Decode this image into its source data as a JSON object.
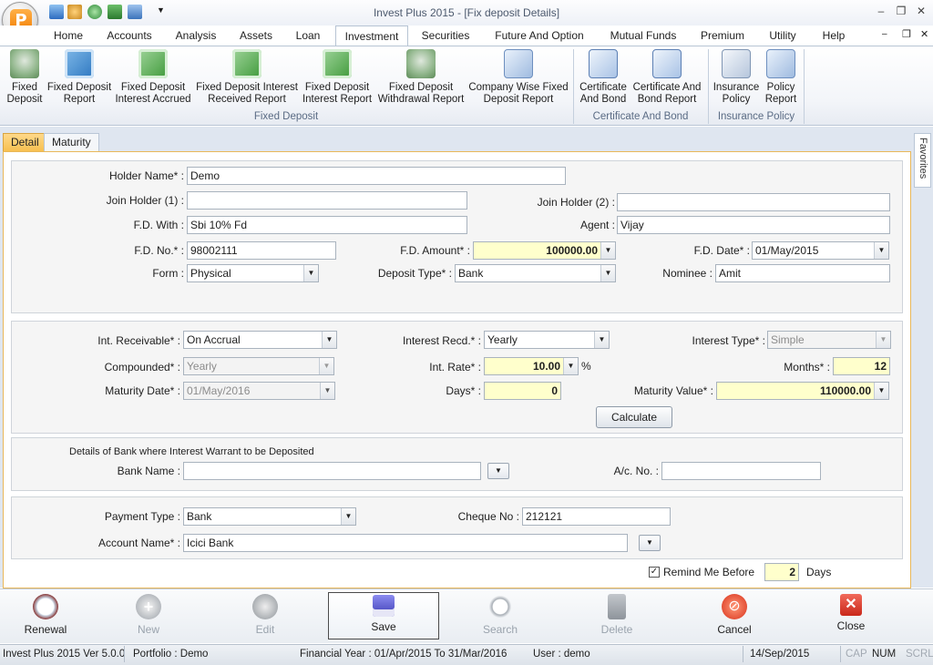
{
  "window": {
    "title": "Invest Plus 2015 - [Fix deposit Details]",
    "logo_letter": "P"
  },
  "menu_tabs": [
    {
      "label": "Home"
    },
    {
      "label": "Accounts"
    },
    {
      "label": "Analysis"
    },
    {
      "label": "Assets"
    },
    {
      "label": "Loan"
    },
    {
      "label": "Investment"
    },
    {
      "label": "Securities"
    },
    {
      "label": "Future And Option"
    },
    {
      "label": "Mutual Funds"
    },
    {
      "label": "Premium"
    },
    {
      "label": "Utility"
    },
    {
      "label": "Help"
    }
  ],
  "active_tab": "Investment",
  "ribbon": {
    "fixed_deposit": {
      "group_label": "Fixed Deposit",
      "buttons": [
        {
          "label": "Fixed\nDeposit",
          "icon": "money-bag-icon"
        },
        {
          "label": "Fixed Deposit\nReport",
          "icon": "report-icon"
        },
        {
          "label": "Fixed Deposit\nInterest Accrued",
          "icon": "calculator-icon"
        },
        {
          "label": "Fixed Deposit Interest\nReceived Report",
          "icon": "calculator-icon"
        },
        {
          "label": "Fixed Deposit\nInterest Report",
          "icon": "calculator-icon"
        },
        {
          "label": "Fixed Deposit\nWithdrawal Report",
          "icon": "withdrawal-icon"
        },
        {
          "label": "Company Wise Fixed\nDeposit Report",
          "icon": "report-icon"
        }
      ]
    },
    "certificate": {
      "group_label": "Certificate And Bond",
      "buttons": [
        {
          "label": "Certificate\nAnd Bond",
          "icon": "certificate-icon"
        },
        {
          "label": "Certificate And\nBond Report",
          "icon": "certificate-report-icon"
        }
      ]
    },
    "insurance": {
      "group_label": "Insurance Policy",
      "buttons": [
        {
          "label": "Insurance\nPolicy",
          "icon": "insurance-icon"
        },
        {
          "label": "Policy\nReport",
          "icon": "policy-report-icon"
        }
      ]
    }
  },
  "sub_tabs": [
    {
      "label": "Detail"
    },
    {
      "label": "Maturity"
    }
  ],
  "favorites_label": "Favorites",
  "form": {
    "holder_name": {
      "label": "Holder Name* :",
      "value": "Demo"
    },
    "join_holder_1": {
      "label": "Join Holder (1) :",
      "value": ""
    },
    "join_holder_2": {
      "label": "Join Holder (2) :",
      "value": ""
    },
    "fd_with": {
      "label": "F.D. With :",
      "value": "Sbi 10% Fd"
    },
    "agent": {
      "label": "Agent :",
      "value": "Vijay"
    },
    "fd_no": {
      "label": "F.D. No.* :",
      "value": "98002111"
    },
    "fd_amount": {
      "label": "F.D. Amount* :",
      "value": "100000.00"
    },
    "fd_date": {
      "label": "F.D. Date* :",
      "value": "01/May/2015"
    },
    "form_type": {
      "label": "Form :",
      "value": "Physical"
    },
    "deposit_type": {
      "label": "Deposit Type* :",
      "value": "Bank"
    },
    "nominee": {
      "label": "Nominee :",
      "value": "Amit"
    },
    "int_receivable": {
      "label": "Int. Receivable* :",
      "value": "On Accrual"
    },
    "interest_recd": {
      "label": "Interest Recd.* :",
      "value": "Yearly"
    },
    "interest_type": {
      "label": "Interest Type* :",
      "value": "Simple"
    },
    "compounded": {
      "label": "Compounded* :",
      "value": "Yearly"
    },
    "int_rate": {
      "label": "Int. Rate* :",
      "value": "10.00",
      "unit": "%"
    },
    "months": {
      "label": "Months* :",
      "value": "12"
    },
    "maturity_date": {
      "label": "Maturity Date* :",
      "value": "01/May/2016"
    },
    "days": {
      "label": "Days* :",
      "value": "0"
    },
    "maturity_value": {
      "label": "Maturity Value* :",
      "value": "110000.00"
    },
    "calculate_label": "Calculate",
    "bank_section_title": "Details of Bank where Interest Warrant to be Deposited",
    "bank_name": {
      "label": "Bank Name :",
      "value": ""
    },
    "ac_no": {
      "label": "A/c. No. :",
      "value": ""
    },
    "payment_type": {
      "label": "Payment Type :",
      "value": "Bank"
    },
    "cheque_no": {
      "label": "Cheque No :",
      "value": "212121"
    },
    "account_name": {
      "label": "Account Name* :",
      "value": "Icici Bank"
    },
    "remind": {
      "label": "Remind Me Before",
      "value": "2",
      "suffix": "Days",
      "checked": true
    }
  },
  "bottom_buttons": [
    {
      "label": "Renewal",
      "icon": "clock-icon",
      "enabled": true
    },
    {
      "label": "New",
      "icon": "plus-icon",
      "enabled": false
    },
    {
      "label": "Edit",
      "icon": "pencil-icon",
      "enabled": false
    },
    {
      "label": "Save",
      "icon": "floppy-icon",
      "enabled": true
    },
    {
      "label": "Search",
      "icon": "magnifier-icon",
      "enabled": false
    },
    {
      "label": "Delete",
      "icon": "trash-icon",
      "enabled": false
    },
    {
      "label": "Cancel",
      "icon": "cancel-icon",
      "enabled": true
    },
    {
      "label": "Close",
      "icon": "close-icon",
      "enabled": true
    }
  ],
  "status": {
    "version": "Invest Plus 2015 Ver 5.0.0",
    "portfolio": "Portfolio : Demo",
    "financial_year": "Financial Year : 01/Apr/2015 To 31/Mar/2016",
    "user": "User : demo",
    "date": "14/Sep/2015",
    "cap": "CAP",
    "num": "NUM",
    "scrl": "SCRL"
  },
  "colors": {
    "accent": "#f7c050",
    "required_bg": "#ffffcc",
    "ribbon_border": "#b7c4d4"
  }
}
